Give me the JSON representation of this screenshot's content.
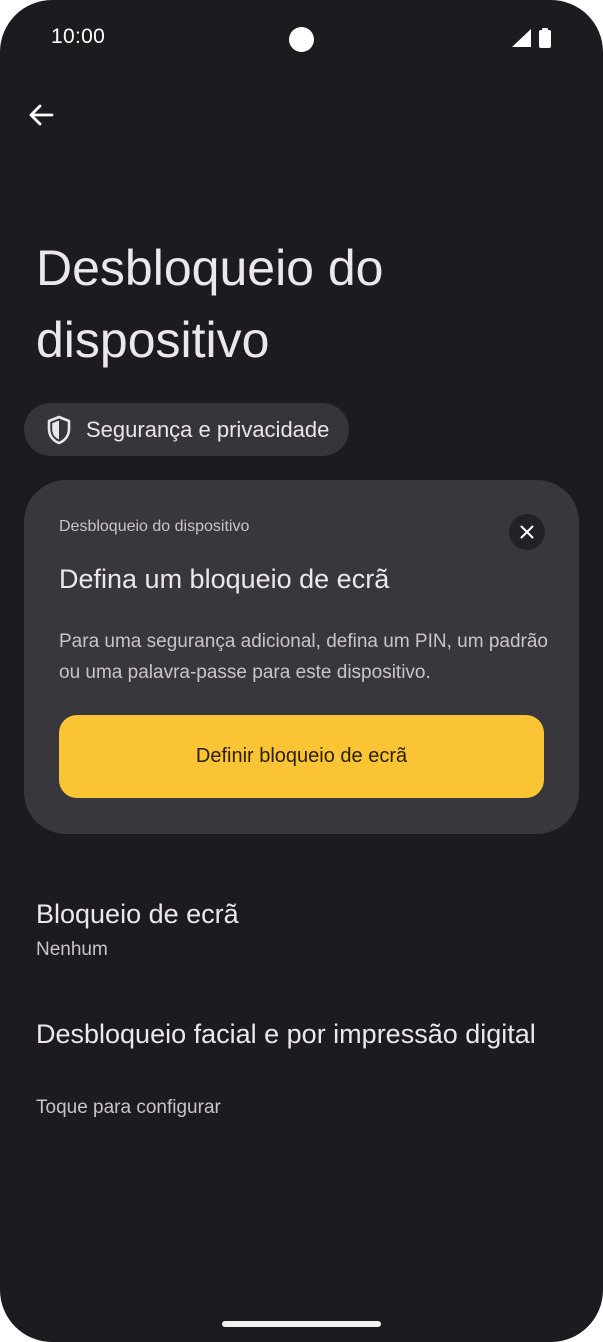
{
  "status_bar": {
    "time": "10:00"
  },
  "header": {
    "back_icon": "arrow-back-icon"
  },
  "page": {
    "title": "Desbloqueio do dispositivo"
  },
  "chip": {
    "icon": "shield-icon",
    "label": "Segurança e privacidade"
  },
  "card": {
    "overline": "Desbloqueio do dispositivo",
    "title": "Defina um bloqueio de ecrã",
    "body": "Para uma segurança adicional, defina um PIN, um padrão ou uma palavra-passe para este dispositivo.",
    "button_label": "Definir bloqueio de ecrã",
    "button_color": "#fbc434",
    "close_icon": "close-icon"
  },
  "preferences": [
    {
      "title": "Bloqueio de ecrã",
      "summary": "Nenhum"
    },
    {
      "title": "Desbloqueio facial e por impressão digital",
      "summary": "Toque para configurar"
    }
  ],
  "colors": {
    "background": "#1c1b20",
    "card_background": "#38373d",
    "chip_background": "#36353a",
    "accent": "#fbc434"
  }
}
